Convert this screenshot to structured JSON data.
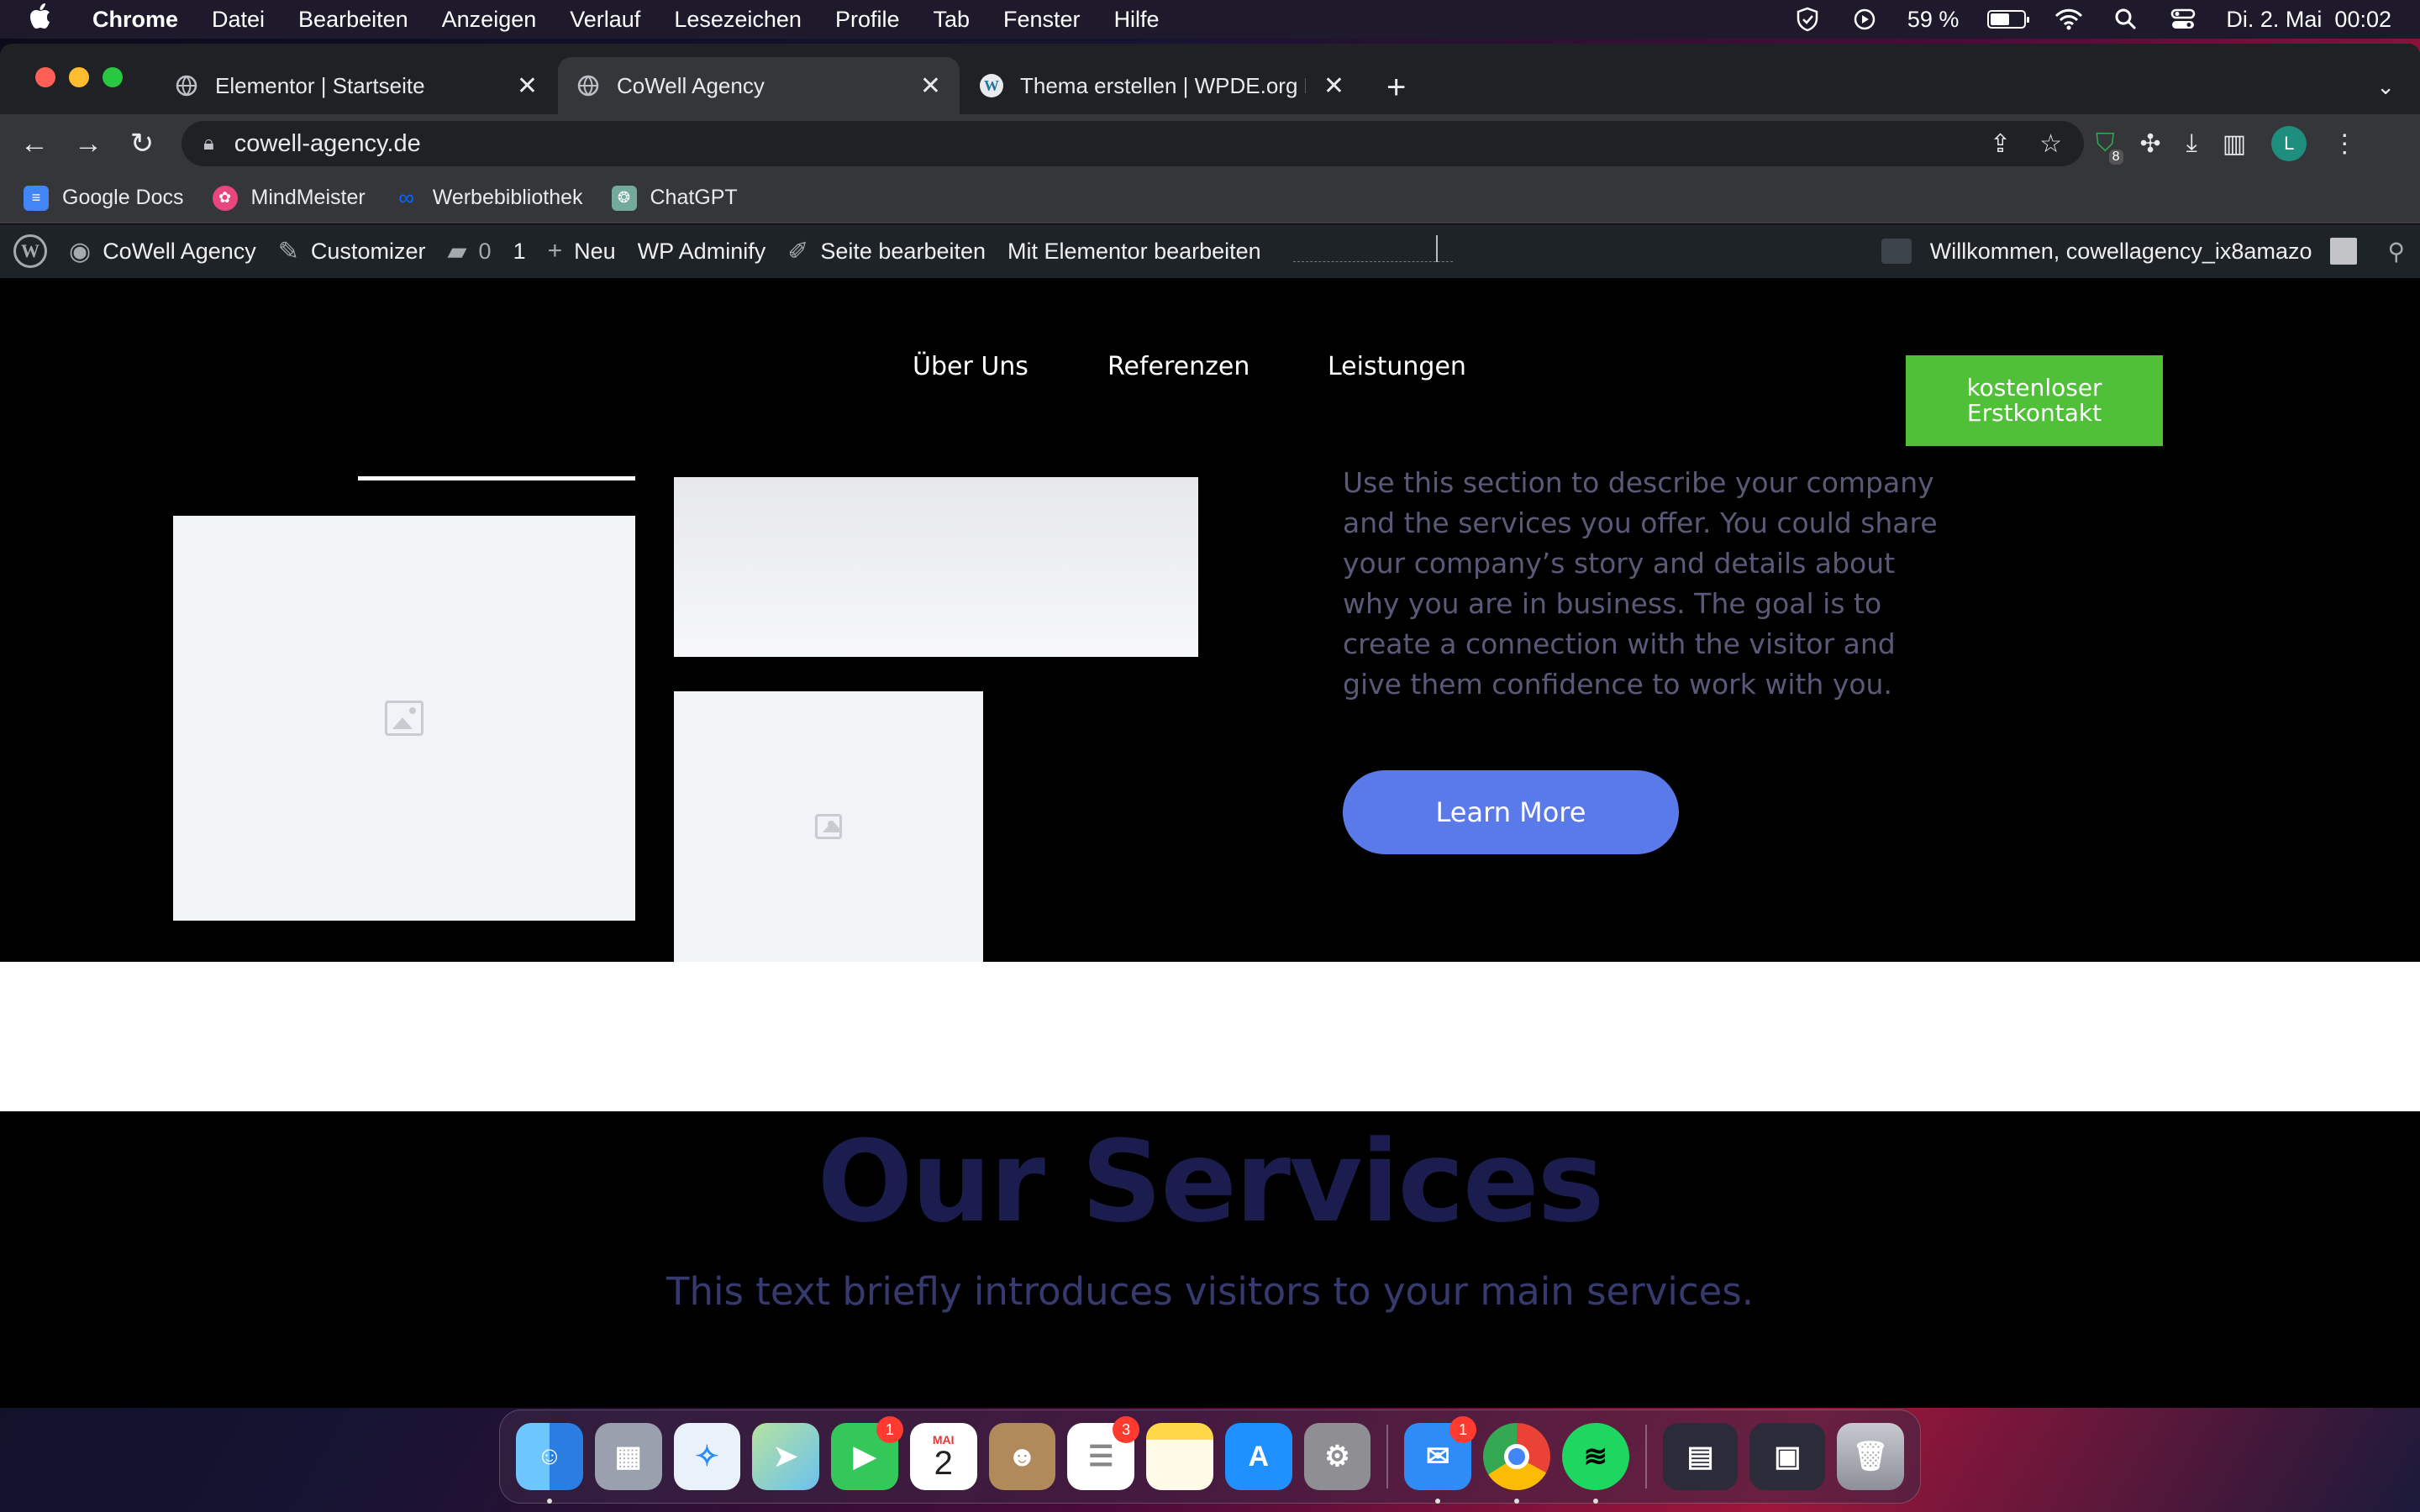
{
  "menubar": {
    "app_name": "Chrome",
    "items": [
      "Datei",
      "Bearbeiten",
      "Anzeigen",
      "Verlauf",
      "Lesezeichen",
      "Profile",
      "Tab",
      "Fenster",
      "Hilfe"
    ],
    "battery_percent": "59 %",
    "battery_level": 0.59,
    "datetime": "Di. 2. Mai  00:02"
  },
  "tabs": [
    {
      "title": "Elementor | Startseite",
      "icon": "globe-icon",
      "active": false
    },
    {
      "title": "CoWell Agency",
      "icon": "globe-icon",
      "active": true
    },
    {
      "title": "Thema erstellen | WPDE.org Fo",
      "icon": "wordpress-icon",
      "active": false
    }
  ],
  "toolbar": {
    "url": "cowell-agency.de",
    "extension_badge": "8",
    "profile_initial": "L"
  },
  "bookmarks": [
    {
      "label": "Google Docs",
      "icon": "google-docs-icon",
      "color": "#4285f4"
    },
    {
      "label": "MindMeister",
      "icon": "mindmeister-icon",
      "color": "#e8467c"
    },
    {
      "label": "Werbebibliothek",
      "icon": "meta-icon",
      "color": "#0866ff"
    },
    {
      "label": "ChatGPT",
      "icon": "chatgpt-icon",
      "color": "#74aa9c"
    }
  ],
  "wpbar": {
    "site_name": "CoWell Agency",
    "customizer": "Customizer",
    "comments_count": "0",
    "updates_count": "1",
    "new_label": "Neu",
    "adminify_label": "WP Adminify",
    "edit_page": "Seite bearbeiten",
    "elementor_edit": "Mit Elementor bearbeiten",
    "welcome": "Willkommen, cowellagency_ix8amazo"
  },
  "site": {
    "nav": [
      "Über Uns",
      "Referenzen",
      "Leistungen"
    ],
    "cta_line1": "kostenloser",
    "cta_line2": "Erstkontakt",
    "about_text": "Use this section to describe your company and the services you offer. You could share your company’s story and details about why you are in business. The goal is to create a connection with the visitor and give them confidence to work with you.",
    "learn_more": "Learn More",
    "services_title": "Our Services",
    "services_intro": "This text briefly introduces visitors to your main services."
  },
  "dock": {
    "apps": [
      {
        "name": "finder",
        "icon": "finder-icon",
        "color": "#3a8ef5",
        "running": true
      },
      {
        "name": "launchpad",
        "icon": "launchpad-icon",
        "color": "#9aa0ae"
      },
      {
        "name": "safari",
        "icon": "safari-icon",
        "color": "#2a8cf0"
      },
      {
        "name": "maps",
        "icon": "maps-icon",
        "color": "#5cbf5a"
      },
      {
        "name": "facetime",
        "icon": "facetime-icon",
        "color": "#34c759",
        "badge": "1"
      },
      {
        "name": "calendar",
        "icon": "calendar-icon",
        "color": "#ffffff",
        "month": "MAI",
        "day": "2"
      },
      {
        "name": "contacts",
        "icon": "contacts-icon",
        "color": "#b08a5a"
      },
      {
        "name": "reminders",
        "icon": "reminders-icon",
        "color": "#ffffff",
        "badge": "3"
      },
      {
        "name": "notes",
        "icon": "notes-icon",
        "color": "#ffd84a"
      },
      {
        "name": "app-store",
        "icon": "app-store-icon",
        "color": "#1e90ff"
      },
      {
        "name": "system-settings",
        "icon": "settings-icon",
        "color": "#8e8e93"
      },
      {
        "name": "mail",
        "icon": "mail-icon",
        "color": "#2f8cf7",
        "badge": "1",
        "running": true
      },
      {
        "name": "chrome",
        "icon": "chrome-icon",
        "color": "#ffffff",
        "running": true
      },
      {
        "name": "spotify",
        "icon": "spotify-icon",
        "color": "#1ed760",
        "running": true
      },
      {
        "name": "downloads-stack",
        "icon": "stack-icon",
        "color": "#2b2b3a"
      },
      {
        "name": "recent-windows",
        "icon": "window-stack-icon",
        "color": "#2b2b3a"
      },
      {
        "name": "trash",
        "icon": "trash-icon",
        "color": "#a9adb6"
      }
    ]
  }
}
